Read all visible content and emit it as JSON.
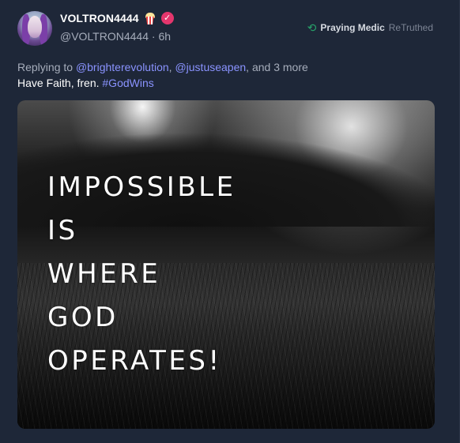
{
  "post": {
    "author": {
      "display_name": "VOLTRON4444",
      "handle": "@VOLTRON4444",
      "time": "6h",
      "separator": "·",
      "avatar_icon": "avatar-image",
      "badge_icon": "popcorn-emoji",
      "verified_icon": "verified-badge-icon",
      "verified_glyph": "✓"
    },
    "retruth": {
      "icon": "retruth-icon",
      "glyph": "⟲",
      "user": "Praying Medic",
      "label": "ReTruthed"
    },
    "reply": {
      "prefix": "Replying to",
      "mentions": [
        "@brighterevolution",
        "@justuseapen"
      ],
      "comma": ",",
      "suffix": ", and 3 more"
    },
    "body": {
      "text": "Have Faith, fren.",
      "hashtag": "#GodWins"
    },
    "media": {
      "lines": [
        "IMPOSSIBLE",
        "IS",
        "WHERE",
        "GOD",
        "OPERATES!"
      ]
    }
  },
  "colors": {
    "background": "#1e2738",
    "accent_link": "#8a93ff",
    "retruth_green": "#27a36a",
    "verified_pink": "#e4366d"
  }
}
